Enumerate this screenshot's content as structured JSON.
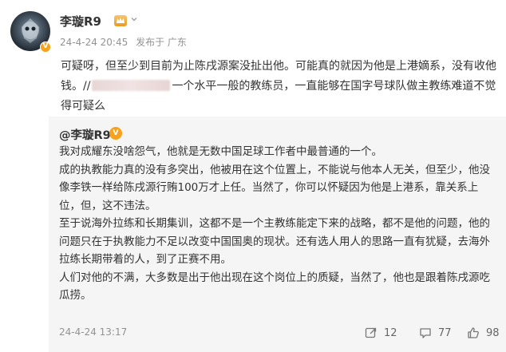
{
  "post": {
    "author": "李璇R9",
    "verified_badge": "V",
    "timestamp": "24-4-24 20:45",
    "source": "发布于 广东",
    "text_part1": "可疑呀，但至少到目前为止陈戌源案没扯出他。可能真的就因为他是上港嫡系，没有收他钱。//",
    "text_part2": "一个水平一般的教练员，一直能够在国字号球队做主教练难道不觉得可疑么"
  },
  "repost": {
    "author": "@李璇R9",
    "verified_badge": "V",
    "paragraphs": [
      "我对成耀东没啥怨气，他就是无数中国足球工作者中最普通的一个。",
      "成的执教能力真的没有多突出，他被用在这个位置上，不能说与他本人无关，但至少，他没像李铁一样给陈戌源行贿100万才上任。当然了，你可以怀疑因为他是上港系，靠关系上位，但，这不违法。",
      "至于说海外拉练和长期集训，这都不是一个主教练能定下来的战略，都不是他的问题，他的问题只在于执教能力不足以改变中国国奥的现状。还有选人用人的思路一直有犹疑，去海外拉练长期带着的人，到了正赛不用。",
      "人们对他的不满，大多数是出于他出现在这个岗位上的质疑，当然了，他也是跟着陈戌源吃瓜捞。"
    ],
    "timestamp": "24-4-24 13:17",
    "share_count": "12",
    "comment_count": "77",
    "like_count": "98"
  },
  "icons": {
    "avatar": "avatar-image",
    "level": "crown-level-icon",
    "chevron": "chevron-down-icon",
    "share": "share-icon",
    "comment": "comment-icon",
    "like": "like-icon"
  },
  "colors": {
    "accent_badge": "#f7a21c",
    "meta_text": "#939393",
    "repost_bg": "#f5f5f5"
  }
}
